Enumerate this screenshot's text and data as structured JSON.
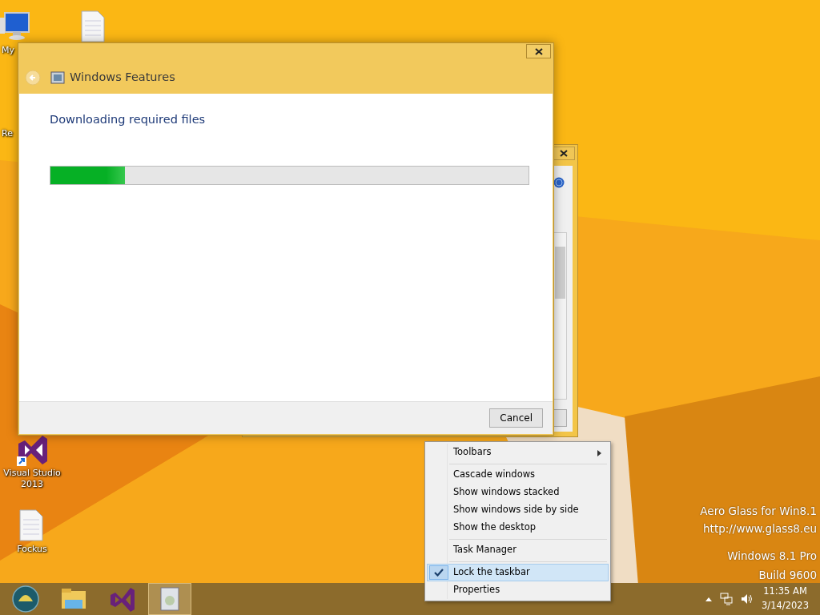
{
  "desktop_icons": [
    {
      "kind": "computer",
      "label": "My"
    },
    {
      "kind": "document"
    },
    {
      "kind": "recycle",
      "label": "Re"
    },
    {
      "kind": "vs",
      "label": "Visual Studio 2013"
    },
    {
      "kind": "document",
      "label": "Fockus"
    }
  ],
  "window": {
    "title": "Windows Features",
    "heading": "Downloading required files",
    "progress": {
      "level": 0.156
    },
    "buttons": [
      "Cancel"
    ]
  },
  "context_menu": [
    {
      "kind": "submenu",
      "label": "Toolbars",
      "checked": false
    },
    {
      "kind": "separator"
    },
    {
      "kind": "item",
      "label": "Cascade windows",
      "checked": false
    },
    {
      "kind": "item",
      "label": "Show windows stacked",
      "checked": false
    },
    {
      "kind": "item",
      "label": "Show windows side by side",
      "checked": false
    },
    {
      "kind": "item",
      "label": "Show the desktop",
      "checked": false
    },
    {
      "kind": "separator"
    },
    {
      "kind": "item",
      "label": "Task Manager",
      "checked": false
    },
    {
      "kind": "separator"
    },
    {
      "kind": "item",
      "label": "Lock the taskbar",
      "checked": true
    },
    {
      "kind": "item",
      "label": "Properties",
      "checked": false
    }
  ],
  "watermark_lines": [
    "Aero Glass for Win8.1",
    "http://www.glass8.eu"
  ],
  "edition_lines": [
    "Windows 8.1 Pro",
    "Build 9600"
  ],
  "taskbar": {
    "apps": [
      {
        "kind": "start",
        "selected": false
      },
      {
        "kind": "explorer",
        "selected": false
      },
      {
        "kind": "vs",
        "selected": false
      },
      {
        "kind": "features",
        "selected": true
      }
    ],
    "clock": {
      "time": "11:35 AM",
      "date": "3/14/2023"
    }
  }
}
